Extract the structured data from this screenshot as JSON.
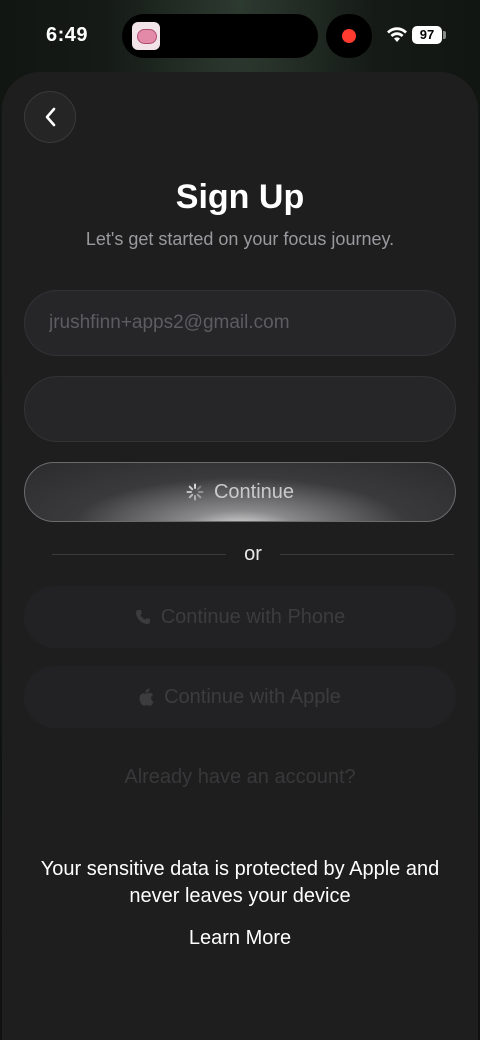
{
  "status_bar": {
    "time": "6:49",
    "battery": "97",
    "recording_color": "#ff3b30"
  },
  "signup": {
    "title": "Sign Up",
    "subtitle": "Let's get started on your focus journey.",
    "email_placeholder": "jrushfinn+apps2@gmail.com",
    "password_value": "",
    "continue_label": "Continue",
    "divider_text": "or",
    "phone_label": "Continue with Phone",
    "apple_label": "Continue with Apple",
    "already_account": "Already have an account?",
    "privacy_text": "Your sensitive data is protected by Apple and never leaves your device",
    "learn_more": "Learn More"
  },
  "icons": [
    "back-chevron-icon",
    "spinner-icon",
    "phone-icon",
    "apple-icon",
    "wifi-icon",
    "app-brain-icon"
  ]
}
